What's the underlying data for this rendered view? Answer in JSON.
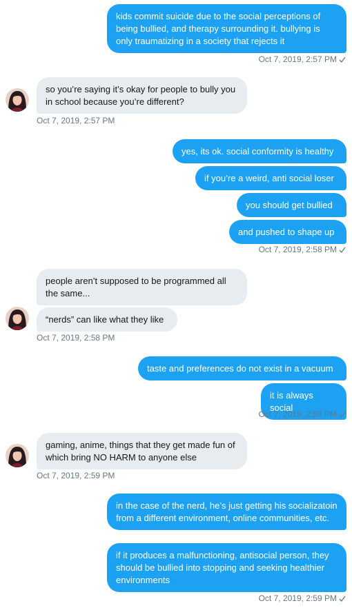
{
  "messages": [
    {
      "text": "kids commit suicide due to the social perceptions of being bullied, and therapy surrounding it. bullying is only traumatizing in a society that rejects it"
    },
    {
      "text": "so you’re saying it’s okay for people to bully you in school because you’re different?"
    },
    {
      "text": "yes, its ok. social conformity is healthy"
    },
    {
      "text": "if you’re a weird, anti social loser"
    },
    {
      "text": "you should get bullied"
    },
    {
      "text": "and pushed to shape up"
    },
    {
      "text": "people aren’t supposed to be programmed all the same..."
    },
    {
      "text": "“nerds” can like what they like"
    },
    {
      "text": "taste and preferences do not exist in a vacuum"
    },
    {
      "text": "it is always social"
    },
    {
      "text": "gaming, anime, things that they get made fun of which bring NO HARM to anyone else"
    },
    {
      "text": "in the case of the nerd, he’s just getting his socializatoin from a different environment, online communities, etc."
    },
    {
      "text": "if it produces a malfunctioning, antisocial person, they should be bullied into stopping and seeking healthier environments"
    }
  ],
  "timestamps": {
    "t1": "Oct 7, 2019, 2:57 PM",
    "t2": "Oct 7, 2019, 2:57 PM",
    "t3": "Oct 7, 2019, 2:58 PM",
    "t4": "Oct 7, 2019, 2:58 PM",
    "t5": "Oct 7, 2019, 2:59 PM",
    "t6": "Oct 7, 2019, 2:59 PM",
    "t7": "Oct 7, 2019, 2:59 PM"
  },
  "icons": {
    "read_receipt": "check-icon",
    "avatar": "avatar"
  },
  "colors": {
    "outgoing": "#1da1f2",
    "incoming": "#e6ecf0",
    "meta": "#657786"
  }
}
